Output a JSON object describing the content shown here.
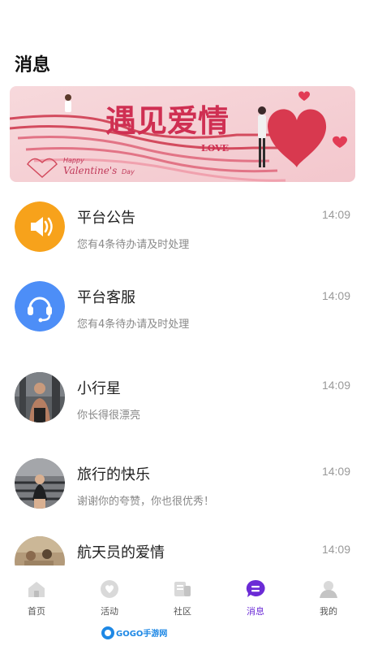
{
  "page": {
    "title": "消息"
  },
  "banner": {
    "headline": "遇见爱情",
    "love": "LOVE",
    "tagline_1": "Happy",
    "tagline_2": "Valentine's",
    "tagline_3": "Day"
  },
  "messages": [
    {
      "name": "平台公告",
      "preview": "您有4条待办请及时处理",
      "time": "14:09",
      "avatar": "speaker-icon"
    },
    {
      "name": "平台客服",
      "preview": "您有4条待办请及时处理",
      "time": "14:09",
      "avatar": "headset-icon"
    },
    {
      "name": "小行星",
      "preview": "你长得很漂亮",
      "time": "14:09",
      "avatar": "user-photo"
    },
    {
      "name": "旅行的快乐",
      "preview": "谢谢你的夸赞，你也很优秀！",
      "time": "14:09",
      "avatar": "user-photo"
    },
    {
      "name": "航天员的爱情",
      "preview": "",
      "time": "14:09",
      "avatar": "user-photo"
    }
  ],
  "tabbar": {
    "active": "消息",
    "accent": "#6b2bd6",
    "items": [
      {
        "label": "首页",
        "icon": "home-icon"
      },
      {
        "label": "活动",
        "icon": "heart-bubble-icon"
      },
      {
        "label": "社区",
        "icon": "community-icon"
      },
      {
        "label": "消息",
        "icon": "message-icon"
      },
      {
        "label": "我的",
        "icon": "profile-icon"
      }
    ]
  },
  "watermark": {
    "text": "GOGO手游网"
  }
}
